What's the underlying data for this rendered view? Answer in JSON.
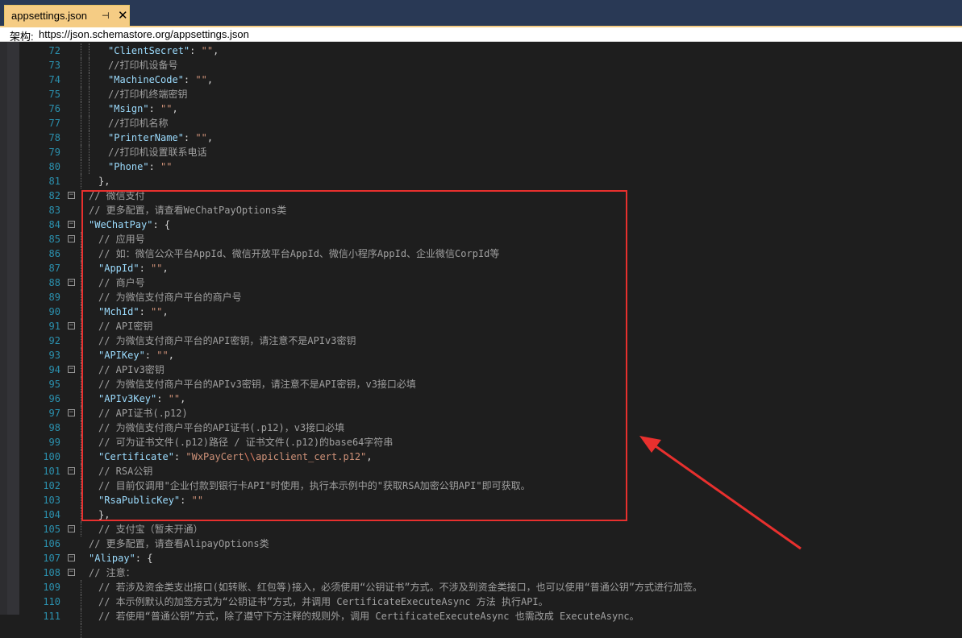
{
  "tab": {
    "title": "appsettings.json",
    "pin": "⊣",
    "close": "✕"
  },
  "schema": {
    "label": "架构:",
    "url": "https://json.schemastore.org/appsettings.json"
  },
  "lines": [
    {
      "n": "72",
      "parts": [
        [
          "k",
          "\"ClientSecret\""
        ],
        [
          "p",
          ": "
        ],
        [
          "s",
          "\"\""
        ],
        [
          "p",
          ","
        ]
      ]
    },
    {
      "n": "73",
      "parts": [
        [
          "gc",
          "//打印机设备号"
        ]
      ]
    },
    {
      "n": "74",
      "parts": [
        [
          "k",
          "\"MachineCode\""
        ],
        [
          "p",
          ": "
        ],
        [
          "s",
          "\"\""
        ],
        [
          "p",
          ","
        ]
      ]
    },
    {
      "n": "75",
      "parts": [
        [
          "gc",
          "//打印机终端密钥"
        ]
      ]
    },
    {
      "n": "76",
      "parts": [
        [
          "k",
          "\"Msign\""
        ],
        [
          "p",
          ": "
        ],
        [
          "s",
          "\"\""
        ],
        [
          "p",
          ","
        ]
      ]
    },
    {
      "n": "77",
      "parts": [
        [
          "gc",
          "//打印机名称"
        ]
      ]
    },
    {
      "n": "78",
      "parts": [
        [
          "k",
          "\"PrinterName\""
        ],
        [
          "p",
          ": "
        ],
        [
          "s",
          "\"\""
        ],
        [
          "p",
          ","
        ]
      ]
    },
    {
      "n": "79",
      "parts": [
        [
          "gc",
          "//打印机设置联系电话"
        ]
      ]
    },
    {
      "n": "80",
      "parts": [
        [
          "k",
          "\"Phone\""
        ],
        [
          "p",
          ": "
        ],
        [
          "s",
          "\"\""
        ]
      ]
    },
    {
      "n": "81",
      "parts": [
        [
          "p",
          "},"
        ]
      ]
    },
    {
      "n": "82",
      "fold": true,
      "parts": [
        [
          "gc",
          "// 微信支付"
        ]
      ]
    },
    {
      "n": "83",
      "parts": [
        [
          "gc",
          "// 更多配置，请查看WeChatPayOptions类"
        ]
      ]
    },
    {
      "n": "84",
      "fold": true,
      "parts": [
        [
          "k",
          "\"WeChatPay\""
        ],
        [
          "p",
          ": {"
        ]
      ]
    },
    {
      "n": "85",
      "fold": true,
      "parts": [
        [
          "gc",
          "// 应用号"
        ]
      ]
    },
    {
      "n": "86",
      "parts": [
        [
          "gc",
          "// 如：微信公众平台AppId、微信开放平台AppId、微信小程序AppId、企业微信CorpId等"
        ]
      ]
    },
    {
      "n": "87",
      "parts": [
        [
          "k",
          "\"AppId\""
        ],
        [
          "p",
          ": "
        ],
        [
          "s",
          "\"\""
        ],
        [
          "p",
          ","
        ]
      ]
    },
    {
      "n": "88",
      "fold": true,
      "parts": [
        [
          "gc",
          "// 商户号"
        ]
      ]
    },
    {
      "n": "89",
      "parts": [
        [
          "gc",
          "// 为微信支付商户平台的商户号"
        ]
      ]
    },
    {
      "n": "90",
      "parts": [
        [
          "k",
          "\"MchId\""
        ],
        [
          "p",
          ": "
        ],
        [
          "s",
          "\"\""
        ],
        [
          "p",
          ","
        ]
      ]
    },
    {
      "n": "91",
      "fold": true,
      "parts": [
        [
          "gc",
          "// API密钥"
        ]
      ]
    },
    {
      "n": "92",
      "parts": [
        [
          "gc",
          "// 为微信支付商户平台的API密钥，请注意不是APIv3密钥"
        ]
      ]
    },
    {
      "n": "93",
      "parts": [
        [
          "k",
          "\"APIKey\""
        ],
        [
          "p",
          ": "
        ],
        [
          "s",
          "\"\""
        ],
        [
          "p",
          ","
        ]
      ]
    },
    {
      "n": "94",
      "fold": true,
      "parts": [
        [
          "gc",
          "// APIv3密钥"
        ]
      ]
    },
    {
      "n": "95",
      "parts": [
        [
          "gc",
          "// 为微信支付商户平台的APIv3密钥，请注意不是API密钥，v3接口必填"
        ]
      ]
    },
    {
      "n": "96",
      "parts": [
        [
          "k",
          "\"APIv3Key\""
        ],
        [
          "p",
          ": "
        ],
        [
          "s",
          "\"\""
        ],
        [
          "p",
          ","
        ]
      ]
    },
    {
      "n": "97",
      "fold": true,
      "parts": [
        [
          "gc",
          "// API证书(.p12)"
        ]
      ]
    },
    {
      "n": "98",
      "parts": [
        [
          "gc",
          "// 为微信支付商户平台的API证书(.p12)，v3接口必填"
        ]
      ]
    },
    {
      "n": "99",
      "parts": [
        [
          "gc",
          "// 可为证书文件(.p12)路径 / 证书文件(.p12)的base64字符串"
        ]
      ]
    },
    {
      "n": "100",
      "parts": [
        [
          "k",
          "\"Certificate\""
        ],
        [
          "p",
          ": "
        ],
        [
          "s",
          "\"WxPayCert"
        ],
        [
          "esc",
          "\\\\"
        ],
        [
          "s",
          "apiclient_cert.p12\""
        ],
        [
          "p",
          ","
        ]
      ]
    },
    {
      "n": "101",
      "fold": true,
      "parts": [
        [
          "gc",
          "// RSA公钥"
        ]
      ]
    },
    {
      "n": "102",
      "parts": [
        [
          "gc",
          "// 目前仅调用\"企业付款到银行卡API\"时使用，执行本示例中的\"获取RSA加密公钥API\"即可获取。"
        ]
      ]
    },
    {
      "n": "103",
      "parts": [
        [
          "k",
          "\"RsaPublicKey\""
        ],
        [
          "p",
          ": "
        ],
        [
          "s",
          "\"\""
        ]
      ]
    },
    {
      "n": "104",
      "parts": [
        [
          "p",
          "},"
        ]
      ]
    },
    {
      "n": "105",
      "fold": true,
      "parts": [
        [
          "gc",
          "// 支付宝（暂未开通）"
        ]
      ]
    },
    {
      "n": "106",
      "parts": [
        [
          "gc",
          "// 更多配置，请查看AlipayOptions类"
        ]
      ]
    },
    {
      "n": "107",
      "fold": true,
      "parts": [
        [
          "k",
          "\"Alipay\""
        ],
        [
          "p",
          ": {"
        ]
      ]
    },
    {
      "n": "108",
      "fold": true,
      "parts": [
        [
          "gc",
          "// 注意："
        ]
      ]
    },
    {
      "n": "109",
      "parts": [
        [
          "gc",
          "// 若涉及资金类支出接口(如转账、红包等)接入，必须使用“公钥证书”方式。不涉及到资金类接口，也可以使用“普通公钥”方式进行加签。"
        ]
      ]
    },
    {
      "n": "110",
      "parts": [
        [
          "gc",
          "// 本示例默认的加签方式为“公钥证书”方式，并调用 CertificateExecuteAsync 方法 执行API。"
        ]
      ]
    },
    {
      "n": "111",
      "parts": [
        [
          "gc",
          "// 若使用“普通公钥”方式，除了遵守下方注释的规则外，调用 CertificateExecuteAsync 也需改成 ExecuteAsync。"
        ]
      ]
    }
  ],
  "indent_levels": [
    3,
    3,
    3,
    3,
    3,
    3,
    3,
    3,
    3,
    2,
    1,
    1,
    1,
    2,
    2,
    2,
    2,
    2,
    2,
    2,
    2,
    2,
    2,
    2,
    2,
    2,
    2,
    2,
    2,
    2,
    2,
    2,
    2,
    2,
    1,
    1,
    1,
    2,
    2,
    2,
    2
  ]
}
